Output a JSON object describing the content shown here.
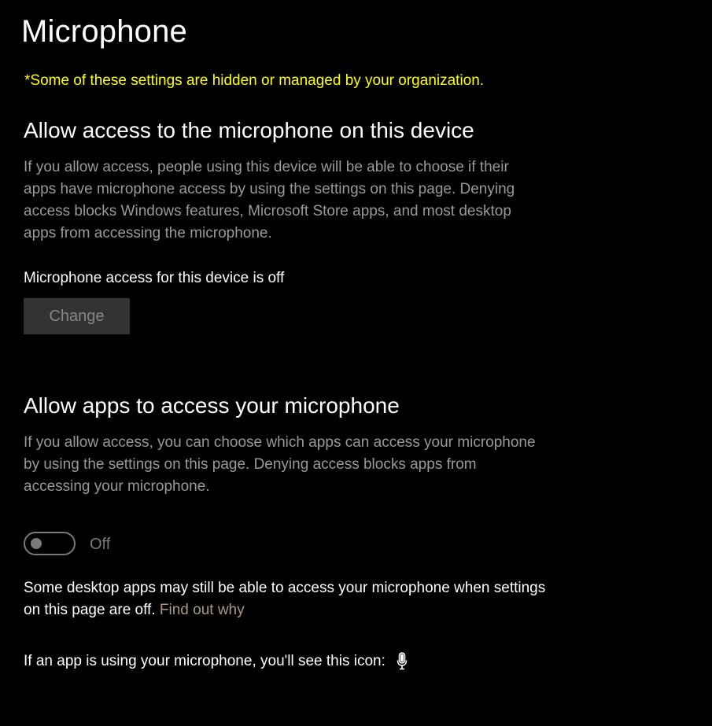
{
  "page": {
    "title": "Microphone",
    "org_notice": "*Some of these settings are hidden or managed by your organization."
  },
  "device_section": {
    "heading": "Allow access to the microphone on this device",
    "description": "If you allow access, people using this device will be able to choose if their apps have microphone access by using the settings on this page. Denying access blocks Windows features, Microsoft Store apps, and most desktop apps from accessing the microphone.",
    "status": "Microphone access for this device is off",
    "change_label": "Change"
  },
  "apps_section": {
    "heading": "Allow apps to access your microphone",
    "description": "If you allow access, you can choose which apps can access your microphone by using the settings on this page. Denying access blocks apps from accessing your microphone.",
    "toggle_state": "Off",
    "toggle_on": false,
    "note_text": "Some desktop apps may still be able to access your microphone when settings on this page are off.",
    "note_link": "Find out why",
    "icon_line": "If an app is using your microphone, you'll see this icon:",
    "icon_name": "microphone-icon"
  },
  "colors": {
    "background": "#000000",
    "org_notice": "#ffff00",
    "description": "#999999",
    "link": "#a89a84",
    "button_bg": "#333333"
  }
}
